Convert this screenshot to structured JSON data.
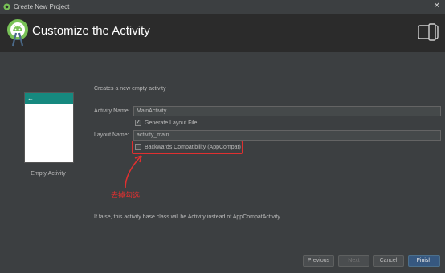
{
  "window": {
    "title": "Create New Project",
    "close_glyph": "✕"
  },
  "header": {
    "title": "Customize the Activity",
    "logo_icon": "android-studio-logo-icon",
    "device_icon": "device-layout-icon"
  },
  "preview": {
    "back_glyph": "←",
    "caption": "Empty Activity",
    "bar_color": "#16897f"
  },
  "form": {
    "description": "Creates a new empty activity",
    "activity_name_label": "Activity Name:",
    "activity_name_value": "MainActivity",
    "generate_layout_label": "Generate Layout File",
    "generate_layout_checked": true,
    "layout_name_label": "Layout Name:",
    "layout_name_value": "activity_main",
    "backwards_compat_label": "Backwards Compatibility (AppCompat)",
    "backwards_compat_checked": false,
    "info_text": "If false, this activity base class will be Activity instead of AppCompatActivity"
  },
  "annotation": {
    "text": "去掉勾选",
    "color": "#e03030"
  },
  "buttons": {
    "previous": "Previous",
    "next": "Next",
    "cancel": "Cancel",
    "finish": "Finish"
  }
}
